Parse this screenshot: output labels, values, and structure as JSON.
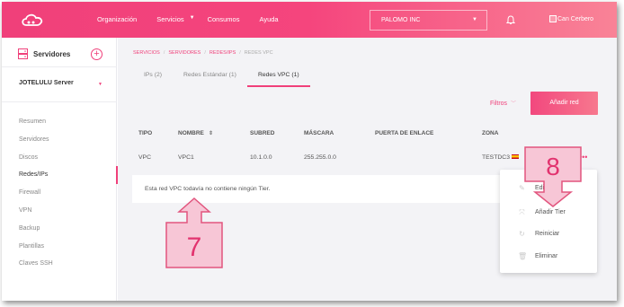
{
  "header": {
    "nav": [
      "Organización",
      "Servicios",
      "Consumos",
      "Ayuda"
    ],
    "org_select": "PALOMO INC",
    "user_alt": "Can Cerbero"
  },
  "sidebar": {
    "title": "Servidores",
    "server": "JOTELULU Server",
    "items": [
      "Resumen",
      "Servidores",
      "Discos",
      "Redes/IPs",
      "Firewall",
      "VPN",
      "Backup",
      "Plantillas",
      "Claves SSH"
    ]
  },
  "breadcrumb": [
    "SERVICIOS",
    "SERVIDORES",
    "REDES/IPS",
    "REDES VPC"
  ],
  "tabs": [
    "IPs (2)",
    "Redes Estándar (1)",
    "Redes VPC (1)"
  ],
  "toolbar": {
    "filters_label": "Filtros",
    "add_label": "Añadir red"
  },
  "table": {
    "headers": [
      "TIPO",
      "NOMBRE",
      "SUBRED",
      "MÁSCARA",
      "PUERTA DE ENLACE",
      "ZONA"
    ],
    "row": {
      "tipo": "VPC",
      "nombre": "VPC1",
      "subred": "10.1.0.0",
      "mascara": "255.255.0.0",
      "puerta": "",
      "zona": "TESTDC3"
    },
    "empty_message": "Esta red VPC todavía no contiene ningún Tier."
  },
  "row_menu": [
    "Editar",
    "Añadir Tier",
    "Reiniciar",
    "Eliminar"
  ],
  "callouts": {
    "step7": "7",
    "step8": "8"
  },
  "colors": {
    "accent": "#f0407a",
    "callout_fill": "#f7c6d6"
  }
}
